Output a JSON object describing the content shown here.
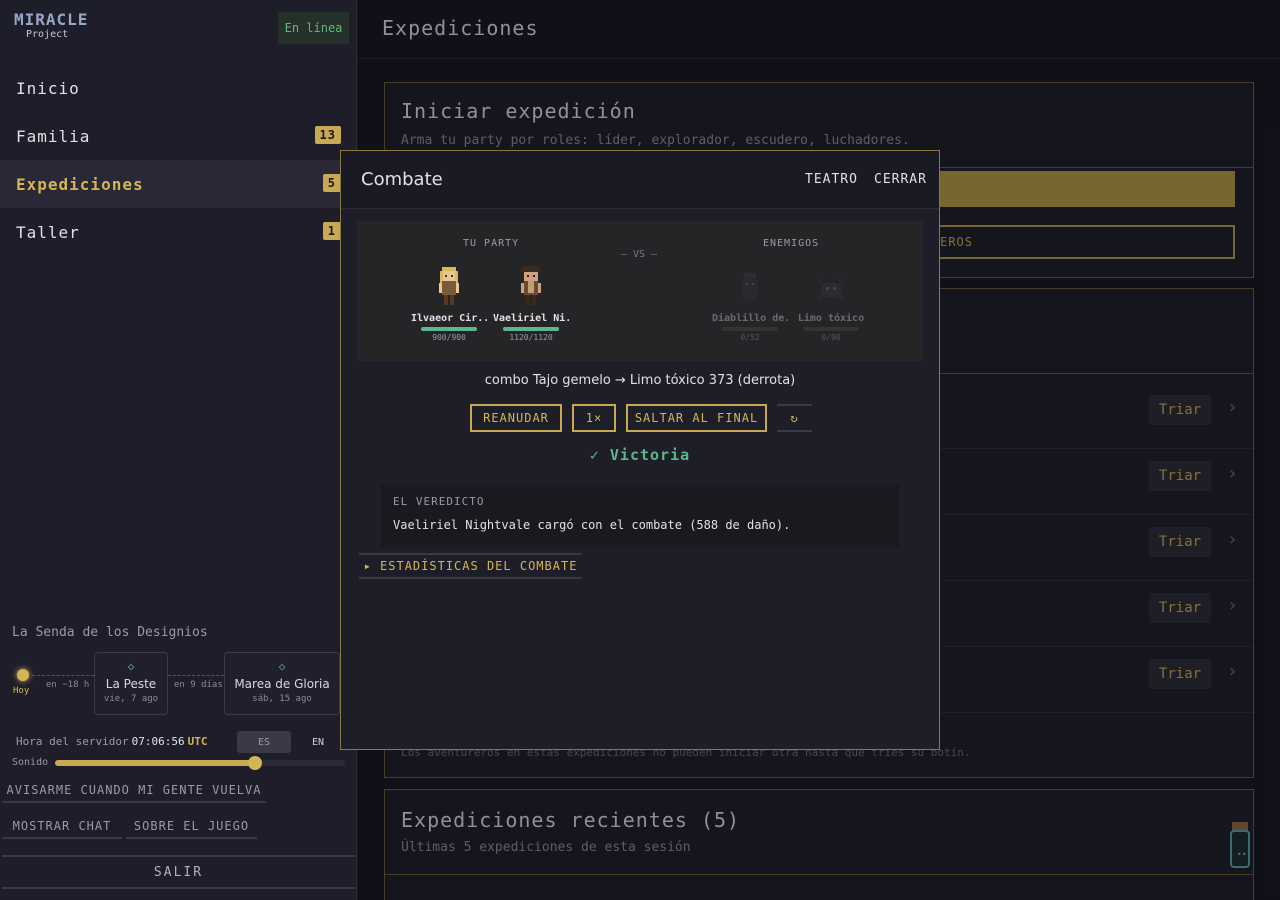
{
  "app": {
    "logo_line1": "MIRACLE",
    "logo_line2": "Project",
    "status": "En línea"
  },
  "nav": [
    {
      "label": "Inicio",
      "badge": ""
    },
    {
      "label": "Familia",
      "badge": "13"
    },
    {
      "label": "Expediciones",
      "badge": "5"
    },
    {
      "label": "Taller",
      "badge": "1"
    }
  ],
  "destiny": {
    "title": "La Senda de los Designios",
    "today": "Hoy",
    "gap1": "en ~18 h",
    "event1": {
      "name": "La Peste",
      "date": "vie, 7 ago"
    },
    "gap2": "en 9 días",
    "event2": {
      "name": "Marea de Gloria",
      "date": "sáb, 15 ago"
    }
  },
  "server": {
    "label": "Hora del servidor",
    "time": "07:06:56",
    "tz": "UTC"
  },
  "lang": {
    "es": "ES",
    "en": "EN"
  },
  "sound": {
    "label": "Sonido",
    "level": 0.69
  },
  "side_buttons": {
    "notify": "AVISARME CUANDO MI GENTE VUELVA",
    "chat": "MOSTRAR CHAT",
    "about": "SOBRE EL JUEGO",
    "logout": "SALIR"
  },
  "main": {
    "title": "Expediciones",
    "start": {
      "title": "Iniciar expedición",
      "subtitle": "Arma tu party por roles: líder, explorador, escudero, luchadores.",
      "select_label": "EROS"
    },
    "triar_label": "Triar",
    "active_note": "Los aventureros en estas expediciones no pueden iniciar otra hasta que tríes su botín.",
    "recent": {
      "title": "Expediciones recientes (5)",
      "subtitle": "Últimas 5 expediciones de esta sesión"
    }
  },
  "modal": {
    "title": "Combate",
    "theater": "TEATRO",
    "close": "CERRAR",
    "party_label": "TU PARTY",
    "vs": "— VS —",
    "enemies_label": "ENEMIGOS",
    "party": [
      {
        "name": "Ilvaeor Cir...",
        "hp": "900/900",
        "hp_frac": 1.0
      },
      {
        "name": "Vaeliriel Ni...",
        "hp": "1120/1120",
        "hp_frac": 1.0
      }
    ],
    "enemies": [
      {
        "name": "Diablillo de...",
        "hp": "0/52",
        "hp_frac": 0
      },
      {
        "name": "Limo tóxico",
        "hp": "0/90",
        "hp_frac": 0
      }
    ],
    "log": "combo Tajo gemelo → Limo tóxico 373 (derrota)",
    "controls": {
      "resume": "REANUDAR",
      "speed": "1×",
      "skip": "SALTAR AL FINAL",
      "replay": "↻"
    },
    "result": "✓ Victoria",
    "verdict_label": "EL VEREDICTO",
    "verdict_text": "Vaeliriel Nightvale cargó con el combate (588 de daño).",
    "stats": "▸ ESTADÍSTICAS DEL COMBATE"
  }
}
